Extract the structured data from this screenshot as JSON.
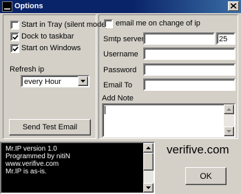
{
  "window": {
    "title": "Options"
  },
  "left_panel": {
    "checkboxes": [
      {
        "label": "Start in Tray (silent mode)",
        "checked": false
      },
      {
        "label": "Dock to taskbar",
        "checked": true
      },
      {
        "label": "Start on Windows",
        "checked": true
      }
    ],
    "refresh_label": "Refresh ip",
    "refresh_value": "every Hour",
    "send_test_label": "Send Test Email"
  },
  "right_panel": {
    "email_checkbox": {
      "label": "email me on change of ip",
      "checked": false
    },
    "smtp_label": "Smtp server",
    "smtp_value": "",
    "port_value": "25",
    "username_label": "Username",
    "username_value": "",
    "password_label": "Password",
    "password_value": "",
    "emailto_label": "Email To",
    "emailto_value": "",
    "note_label": "Add Note",
    "note_value": ""
  },
  "log": {
    "lines": [
      "Mr.IP version  1.0",
      "",
      "Programmed by nitiN",
      "www.verifive.com",
      "Mr.IP is as-is."
    ]
  },
  "brand": "verifive.com",
  "ok_label": "OK"
}
